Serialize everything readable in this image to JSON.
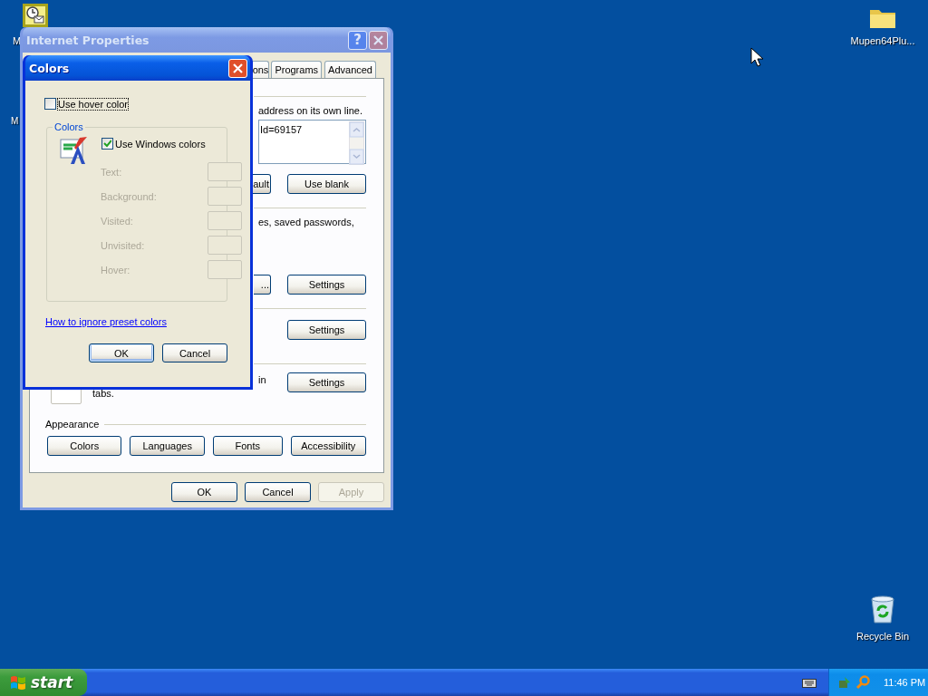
{
  "desktop_icons": [
    {
      "kind": "scheduler",
      "label": "M"
    },
    {
      "kind": "covered",
      "label": "M"
    },
    {
      "kind": "folder",
      "label": "Mupen64Plu..."
    },
    {
      "kind": "recycle_bin",
      "label": "Recycle Bin"
    }
  ],
  "internet_properties": {
    "title": "Internet Properties",
    "active": false,
    "help_label": "?",
    "tabs": [
      {
        "label": "ons",
        "selected": false
      },
      {
        "label": "Programs",
        "selected": false
      },
      {
        "label": "Advanced",
        "selected": false
      }
    ],
    "panel": [
      {
        "kind": "rule"
      },
      {
        "kind": "text",
        "text": "address on its own line."
      },
      {
        "kind": "field",
        "value": "Id=69157"
      },
      {
        "kind": "buttons",
        "buttons": [
          {
            "label": "ault",
            "cut": true
          },
          {
            "label": "Use blank",
            "cut": false
          }
        ]
      },
      {
        "kind": "rule"
      },
      {
        "kind": "text",
        "text": "es, saved passwords,"
      },
      {
        "kind": "buttons",
        "buttons": [
          {
            "label": "...",
            "cut": true
          },
          {
            "label": "Settings",
            "cut": false
          }
        ]
      },
      {
        "kind": "rule"
      },
      {
        "kind": "buttons",
        "buttons": [
          {
            "label": "Settings",
            "cut": false
          }
        ]
      },
      {
        "kind": "rule"
      },
      {
        "kind": "option",
        "line_end": "in",
        "second_line": "tabs.",
        "button": "Settings"
      },
      {
        "kind": "section",
        "title": "Appearance"
      },
      {
        "kind": "wide_buttons",
        "buttons": [
          {
            "label": "Colors"
          },
          {
            "label": "Languages"
          },
          {
            "label": "Fonts"
          },
          {
            "label": "Accessibility"
          }
        ]
      }
    ],
    "buttons": [
      {
        "label": "OK",
        "disabled": false
      },
      {
        "label": "Cancel",
        "disabled": false
      },
      {
        "label": "Apply",
        "disabled": true
      }
    ]
  },
  "colors_dialog": {
    "title": "Colors",
    "active": true,
    "hover_checkbox": {
      "label": "Use hover color",
      "checked": false
    },
    "group": {
      "title": "Colors",
      "windows_colors": {
        "label": "Use Windows colors",
        "checked": true
      },
      "color_rows": [
        {
          "label": "Text:",
          "disabled": true
        },
        {
          "label": "Background:",
          "disabled": true
        },
        {
          "label": "Visited:",
          "disabled": true
        },
        {
          "label": "Unvisited:",
          "disabled": true
        },
        {
          "label": "Hover:",
          "disabled": true
        }
      ]
    },
    "link": "How to ignore preset colors",
    "buttons": [
      {
        "label": "OK",
        "default": true
      },
      {
        "label": "Cancel",
        "default": false
      }
    ]
  },
  "taskbar": {
    "start_label": "start",
    "time": "11:46 PM"
  }
}
